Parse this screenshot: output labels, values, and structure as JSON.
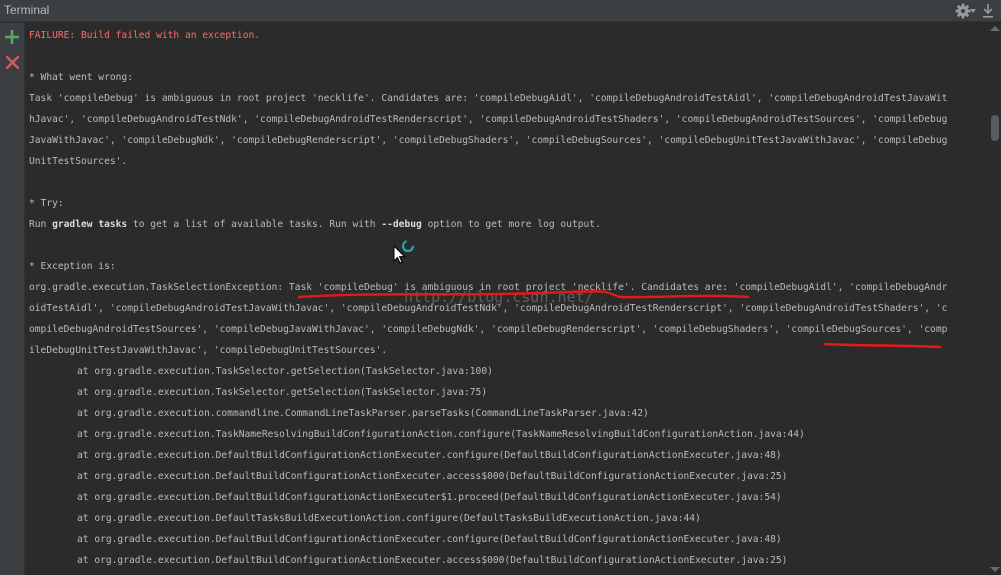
{
  "window": {
    "title": "Terminal"
  },
  "icons": {
    "settings": "gear-icon",
    "hide": "hide-icon",
    "add": "plus-icon",
    "close": "close-icon"
  },
  "colors": {
    "background": "#2b2b2b",
    "text": "#bbbbbb",
    "failure": "#ff6b68",
    "accent": "#26a6b0",
    "annotation": "#e81818"
  },
  "terminal": {
    "failure": "FAILURE: Build failed with an exception.",
    "wrong_header": "* What went wrong:",
    "wrong_lines": [
      "Task 'compileDebug' is ambiguous in root project 'necklife'. Candidates are: 'compileDebugAidl', 'compileDebugAndroidTestAidl', 'compileDebugAndroidTestJavaWit",
      "hJavac', 'compileDebugAndroidTestNdk', 'compileDebugAndroidTestRenderscript', 'compileDebugAndroidTestShaders', 'compileDebugAndroidTestSources', 'compileDebug",
      "JavaWithJavac', 'compileDebugNdk', 'compileDebugRenderscript', 'compileDebugShaders', 'compileDebugSources', 'compileDebugUnitTestJavaWithJavac', 'compileDebug",
      "UnitTestSources'."
    ],
    "try_header": "* Try:",
    "try_prefix": "Run ",
    "try_cmd": "gradlew tasks",
    "try_mid": " to get a list of available tasks. Run with ",
    "try_flag": "--debug",
    "try_suffix": " option to get more log output.",
    "exception_header": "* Exception is:",
    "exception_lines": [
      "org.gradle.execution.TaskSelectionException: Task 'compileDebug' is ambiguous in root project 'necklife'. Candidates are: 'compileDebugAidl', 'compileDebugAndr",
      "oidTestAidl', 'compileDebugAndroidTestJavaWithJavac', 'compileDebugAndroidTestNdk', 'compileDebugAndroidTestRenderscript', 'compileDebugAndroidTestShaders', 'c",
      "ompileDebugAndroidTestSources', 'compileDebugJavaWithJavac', 'compileDebugNdk', 'compileDebugRenderscript', 'compileDebugShaders', 'compileDebugSources', 'comp",
      "ileDebugUnitTestJavaWithJavac', 'compileDebugUnitTestSources'."
    ],
    "stack": [
      "at org.gradle.execution.TaskSelector.getSelection(TaskSelector.java:100)",
      "at org.gradle.execution.TaskSelector.getSelection(TaskSelector.java:75)",
      "at org.gradle.execution.commandline.CommandLineTaskParser.parseTasks(CommandLineTaskParser.java:42)",
      "at org.gradle.execution.TaskNameResolvingBuildConfigurationAction.configure(TaskNameResolvingBuildConfigurationAction.java:44)",
      "at org.gradle.execution.DefaultBuildConfigurationActionExecuter.configure(DefaultBuildConfigurationActionExecuter.java:48)",
      "at org.gradle.execution.DefaultBuildConfigurationActionExecuter.access$000(DefaultBuildConfigurationActionExecuter.java:25)",
      "at org.gradle.execution.DefaultBuildConfigurationActionExecuter$1.proceed(DefaultBuildConfigurationActionExecuter.java:54)",
      "at org.gradle.execution.DefaultTasksBuildExecutionAction.configure(DefaultTasksBuildExecutionAction.java:44)",
      "at org.gradle.execution.DefaultBuildConfigurationActionExecuter.configure(DefaultBuildConfigurationActionExecuter.java:48)",
      "at org.gradle.execution.DefaultBuildConfigurationActionExecuter.access$000(DefaultBuildConfigurationActionExecuter.java:25)"
    ]
  },
  "watermark": "http://blog.csdn.net/"
}
